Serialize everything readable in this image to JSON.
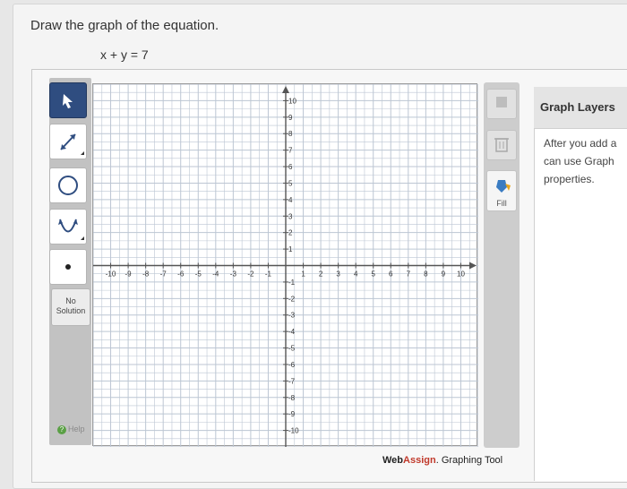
{
  "question": {
    "instruction": "Draw the graph of the equation.",
    "equation": "x + y = 7"
  },
  "tools": [
    {
      "name": "pointer-icon",
      "active": true
    },
    {
      "name": "line-icon",
      "active": false
    },
    {
      "name": "circle-icon",
      "active": false
    },
    {
      "name": "parabola-icon",
      "active": false
    },
    {
      "name": "point-icon",
      "active": false
    }
  ],
  "no_solution_label": "No Solution",
  "help_label": "Help",
  "right_tools": {
    "graph_layers_label": "Graph Layers",
    "delete_label": "Delete",
    "fill_label": "Fill"
  },
  "brand": {
    "part1": "Web",
    "part2": "Assign",
    "suffix": ". Graphing Tool"
  },
  "layers_panel": {
    "title": "Graph Layers",
    "description": "After you add a can use Graph properties."
  },
  "chart_data": {
    "type": "scatter",
    "title": "",
    "xlabel": "",
    "ylabel": "",
    "xlim": [
      -11,
      11
    ],
    "ylim": [
      -11,
      11
    ],
    "grid": true,
    "x_ticks": [
      -10,
      -9,
      -8,
      -7,
      -6,
      -5,
      -4,
      -3,
      -2,
      -1,
      1,
      2,
      3,
      4,
      5,
      6,
      7,
      8,
      9,
      10
    ],
    "y_ticks": [
      10,
      9,
      8,
      7,
      6,
      5,
      4,
      3,
      2,
      1,
      -1,
      -2,
      -3,
      -4,
      -5,
      -6,
      -7,
      -8,
      -9,
      -10
    ],
    "series": []
  },
  "colors": {
    "accent": "#2f4d80",
    "grid": "#bcc6d3",
    "axis": "#555555",
    "brand_red": "#c0392b"
  }
}
